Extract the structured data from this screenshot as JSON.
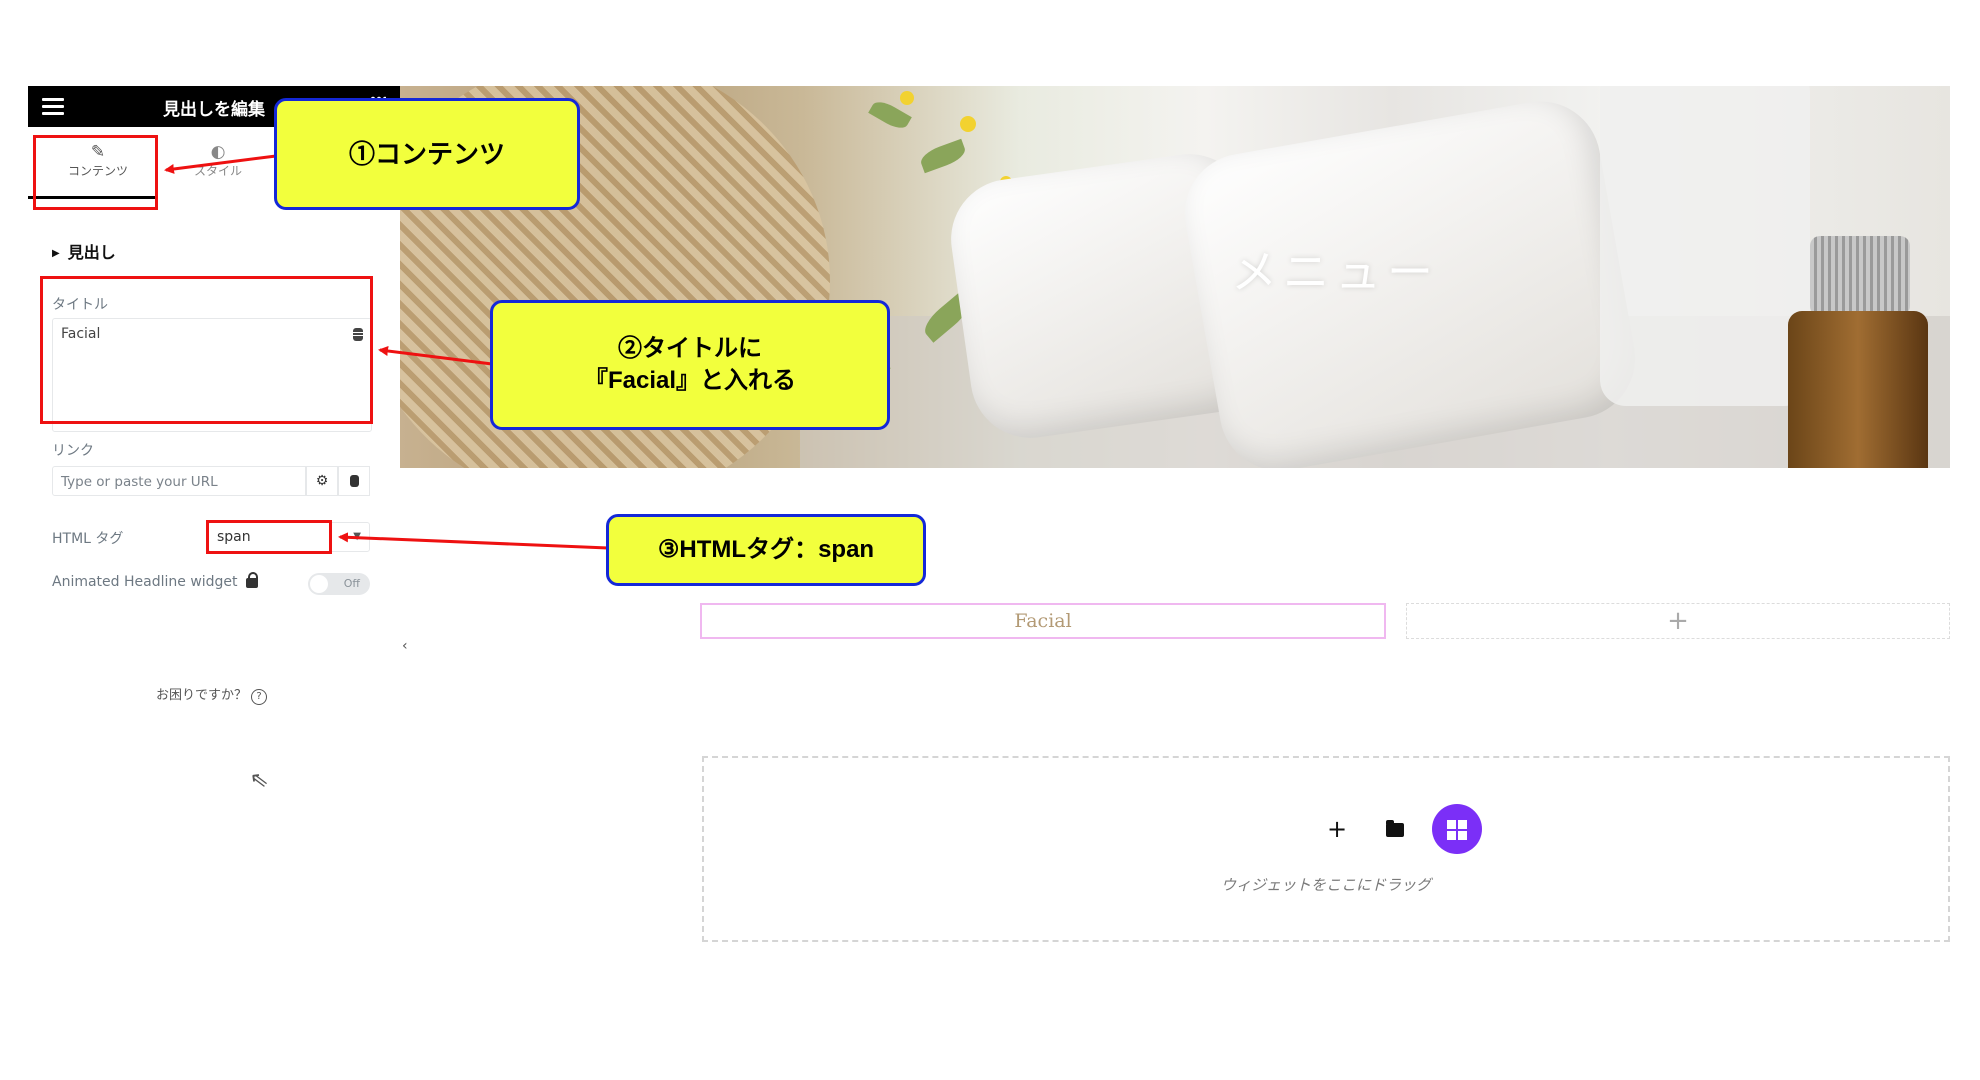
{
  "panel": {
    "header_title": "見出しを編集",
    "tabs": [
      {
        "label": "コンテンツ",
        "icon": "pencil-icon"
      },
      {
        "label": "スタイル",
        "icon": "half-circle-icon"
      }
    ],
    "section_title": "見出し",
    "title_label": "タイトル",
    "title_value": "Facial",
    "link_label": "リンク",
    "link_placeholder": "Type or paste your URL",
    "html_tag_label": "HTML タグ",
    "html_tag_value": "span",
    "animated_label": "Animated Headline widget",
    "animated_toggle": "Off",
    "help_text": "お困りですか？",
    "help_icon": "?"
  },
  "preview": {
    "hero_title": "メニュー",
    "heading_text": "Facial",
    "add_column": "+",
    "dropzone_text": "ウィジェットをここにドラッグ"
  },
  "annotations": {
    "callout1": "①コンテンツ",
    "callout2_line1": "②タイトルに",
    "callout2_line2": "『Facial』と入れる",
    "callout3": "③HTMLタグ：span"
  },
  "colors": {
    "annotation_red": "#ee1111",
    "callout_fill": "#f2ff3d",
    "callout_border": "#1428d8",
    "kit_purple": "#7b2ff7"
  }
}
